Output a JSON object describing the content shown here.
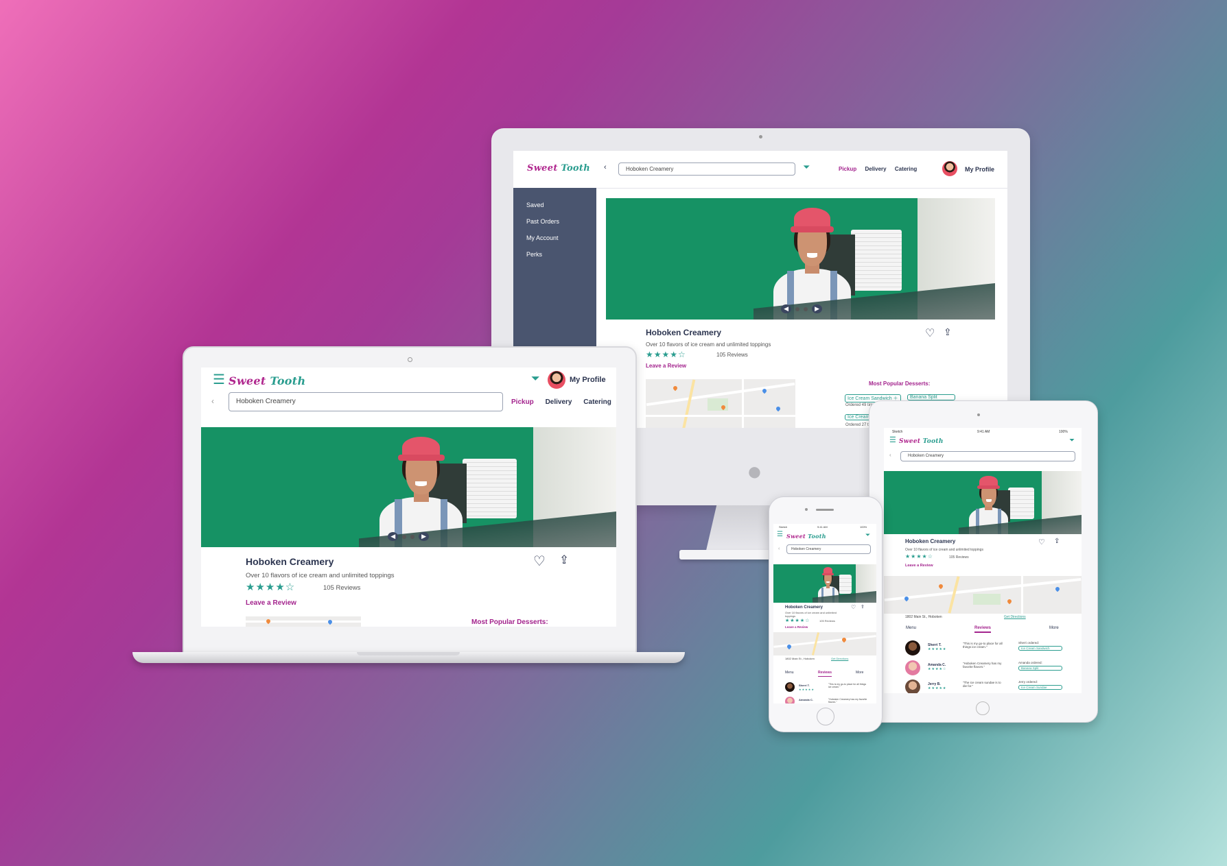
{
  "brand": {
    "logo_part1": "Sweet",
    "logo_part2": "Tooth",
    "accent": "#a3238d",
    "teal": "#2a9d8f",
    "navy": "#2c3550"
  },
  "search": {
    "value": "Hoboken Creamery"
  },
  "nav": {
    "pickup": "Pickup",
    "delivery": "Delivery",
    "catering": "Catering",
    "profile": "My Profile"
  },
  "sidebar": {
    "items": [
      {
        "label": "Saved"
      },
      {
        "label": "Past Orders"
      },
      {
        "label": "My Account"
      },
      {
        "label": "Perks"
      }
    ]
  },
  "store": {
    "name": "Hoboken Creamery",
    "tagline": "Over 10 flavors of ice cream and unlimited toppings",
    "rating": 4.5,
    "stars": "★★★★☆",
    "reviews": "105 Reviews",
    "leave_review": "Leave a Review",
    "address": "1802 Main St., Hoboken",
    "directions": "Get Directions"
  },
  "popular": {
    "title": "Most Popular Desserts:",
    "items": [
      {
        "label": "Ice Cream Sandwich",
        "ordered": "Ordered 49 tim"
      },
      {
        "label": "Banana Split"
      },
      {
        "label": "Ice Cream S",
        "ordered": "Ordered 27 ti"
      }
    ]
  },
  "tabs": {
    "menu": "Menu",
    "reviews": "Reviews",
    "more": "More"
  },
  "reviews": [
    {
      "name": "Sherri T.",
      "stars": "★★★★★",
      "quote": "\"This is my go-to place for all things ice cream.\"",
      "ordered_label": "Sherri ordered:",
      "item": "Ice Cream Sandwich"
    },
    {
      "name": "Amanda C.",
      "stars": "★★★★☆",
      "quote": "\"Hoboken Creamery has my favorite flavors.\"",
      "ordered_label": "Amanda ordered:",
      "item": "Banana Split"
    },
    {
      "name": "Jerry B.",
      "stars": "★★★★★",
      "quote": "\"The ice cream sundae is to die for.\"",
      "ordered_label": "Jerry ordered:",
      "item": "Ice Cream Sundae"
    }
  ],
  "phone_status": {
    "carrier": "Sketch",
    "time": "9:41 AM",
    "battery": "100%"
  },
  "icons": [
    "hamburger-icon",
    "filter-icon",
    "back-chevron-icon",
    "heart-icon",
    "share-icon",
    "plus-icon",
    "apple-logo-icon"
  ]
}
